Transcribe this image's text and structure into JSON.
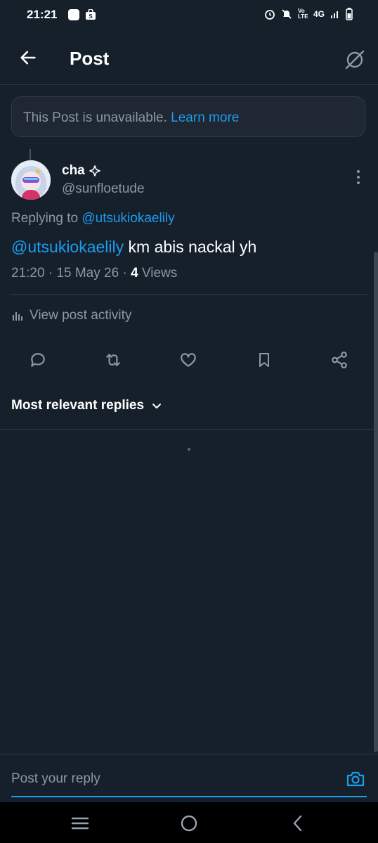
{
  "status_bar": {
    "time": "21:21",
    "network": "4G",
    "volte": "Vo LTE"
  },
  "header": {
    "title": "Post",
    "back_icon": "arrow-left-icon",
    "grok_icon": "grok-icon"
  },
  "notice": {
    "text": "This Post is unavailable.",
    "link": "Learn more"
  },
  "post": {
    "display_name": "cha",
    "badge_icon": "sparkle-icon",
    "handle": "@sunfloetude",
    "replying_label": "Replying to",
    "replying_to": "@utsukiokaelily",
    "mention": "@utsukiokaelily",
    "text": "km abis nackal yh",
    "time": "21:20",
    "date": "15 May 26",
    "views_count": "4",
    "views_label": "Views",
    "activity_label": "View post activity"
  },
  "actions": [
    "reply-icon",
    "repost-icon",
    "like-icon",
    "bookmark-icon",
    "share-icon"
  ],
  "replies": {
    "sort_label": "Most relevant replies"
  },
  "composer": {
    "placeholder": "Post your reply"
  },
  "colors": {
    "background": "#15202b",
    "accent": "#1d9bf0",
    "secondary_text": "#8b98a5",
    "divider": "#2f3b47"
  }
}
